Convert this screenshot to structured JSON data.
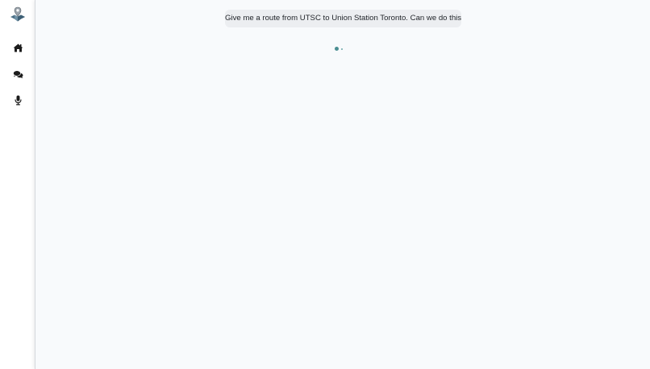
{
  "sidebar": {
    "logo": {
      "icon": "map-pin-logo-icon"
    },
    "items": [
      {
        "icon": "home-icon",
        "name": "home"
      },
      {
        "icon": "chat-icon",
        "name": "chat"
      },
      {
        "icon": "microphone-icon",
        "name": "voice"
      }
    ]
  },
  "chat": {
    "messages": [
      {
        "role": "user",
        "text": "Give me a route from UTSC to Union Station Toronto. Can we do this?"
      }
    ],
    "typing_indicator": {
      "visible": true
    }
  },
  "colors": {
    "main_background": "#f8fafc",
    "bubble_background": "#eceef1",
    "accent": "#4a8e92",
    "icon": "#1c1c1c"
  }
}
